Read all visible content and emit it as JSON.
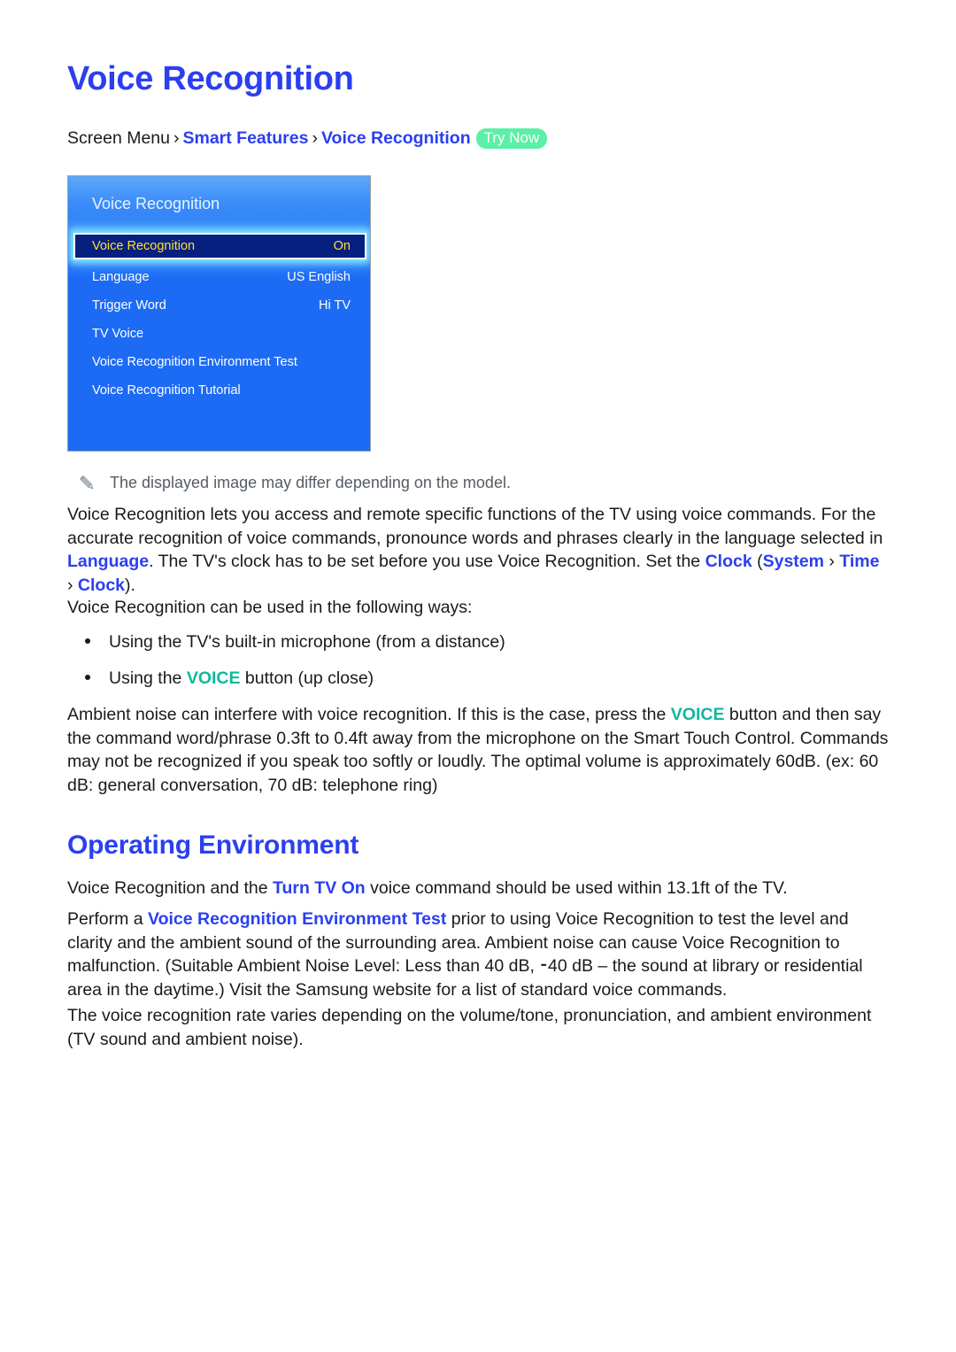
{
  "page": {
    "title": "Voice Recognition"
  },
  "breadcrumb": {
    "root": "Screen Menu",
    "sep": "›",
    "level1": "Smart Features",
    "level2": "Voice Recognition",
    "badge": "Try Now"
  },
  "tv_panel": {
    "header_title": "Voice Recognition",
    "highlight": {
      "label": "Voice Recognition",
      "value": "On"
    },
    "rows": [
      {
        "label": "Language",
        "value": "US English"
      },
      {
        "label": "Trigger Word",
        "value": "Hi TV"
      },
      {
        "label": "TV Voice",
        "value": ""
      },
      {
        "label": "Voice Recognition Environment Test",
        "value": ""
      },
      {
        "label": "Voice Recognition Tutorial",
        "value": ""
      }
    ]
  },
  "note": {
    "icon": "pencil-icon",
    "text": "The displayed image may differ depending on the model."
  },
  "intro": {
    "part1": "Voice Recognition lets you access and remote specific functions of the TV using voice commands. For the accurate recognition of voice commands, pronounce words and phrases clearly in the language selected in ",
    "link_language": "Language",
    "part2": ". The TV's clock has to be set before you use Voice Recognition. Set the ",
    "link_clock": "Clock",
    "part3": " (",
    "link_system": "System",
    "sep1": " › ",
    "link_time": "Time",
    "sep2": " › ",
    "link_clock2": "Clock",
    "part4": ")."
  },
  "ways": {
    "lead": "Voice Recognition can be used in the following ways:",
    "bullets": [
      {
        "pre": "Using the TV's built-in microphone (from a distance)",
        "highlight": "",
        "post": ""
      },
      {
        "pre": "Using the ",
        "highlight": "VOICE",
        "post": " button (up close)"
      }
    ]
  },
  "ambient": {
    "part1": "Ambient noise can interfere with voice recognition. If this is the case, press the ",
    "voice": "VOICE",
    "part2": " button and then say the command word/phrase 0.3ft to 0.4ft away from the microphone on the Smart Touch Control. Commands may not be recognized if you speak too softly or loudly. The optimal volume is approximately 60dB. (ex: 60 dB: general conversation, 70 dB: telephone ring)"
  },
  "operating_environment": {
    "heading": "Operating Environment",
    "p1_part1": "Voice Recognition and the ",
    "p1_link": "Turn TV On",
    "p1_part2": " voice command should be used within 13.1ft of the TV.",
    "p2_part1": "Perform a ",
    "p2_link": "Voice Recognition Environment Test",
    "p2_part2": " prior to using Voice Recognition to test the level and clarity and the ambient sound of the surrounding area. Ambient noise can cause Voice Recognition to malfunction. (Suitable Ambient Noise Level: Less than 40 dB, ⁃40 dB – the sound at library or residential area in the daytime.) Visit the Samsung website for a list of standard voice commands.",
    "p3": "The voice recognition rate varies depending on the volume/tone, pronunciation, and ambient environment (TV sound and ambient noise)."
  },
  "colors": {
    "link_blue": "#2b3ff0",
    "teal": "#12b89b",
    "badge_green": "#5bf0a5",
    "tv_blue": "#1d6bf5",
    "tv_highlight_navy": "#071f7e",
    "tv_highlight_text": "#ffe033"
  }
}
